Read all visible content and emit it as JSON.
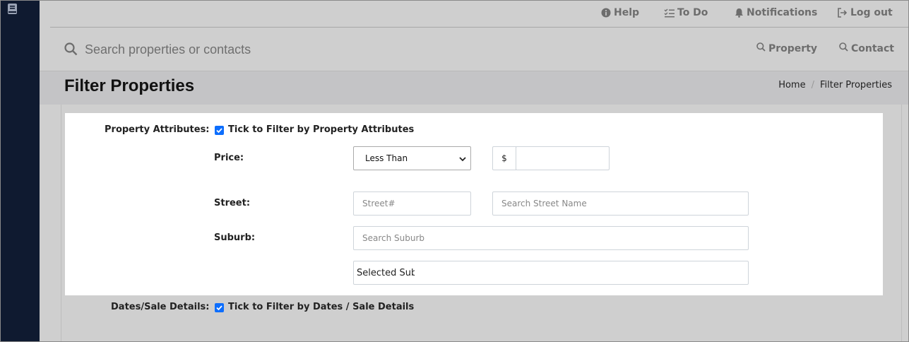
{
  "topnav": {
    "help": "Help",
    "todo": "To Do",
    "notifications": "Notifications",
    "logout": "Log out"
  },
  "search": {
    "placeholder": "Search properties or contacts",
    "property_label": "Property",
    "contact_label": "Contact"
  },
  "page": {
    "title": "Filter Properties",
    "breadcrumb": [
      "Home",
      "Filter Properties"
    ]
  },
  "filters": {
    "property_attributes": {
      "label": "Property Attributes:",
      "checkbox_label": "Tick to Filter by Property Attributes",
      "checked": true,
      "price": {
        "label": "Price:",
        "comparator": "Less Than",
        "currency": "$",
        "value": ""
      },
      "street": {
        "label": "Street:",
        "number_placeholder": "Street#",
        "name_placeholder": "Search Street Name"
      },
      "suburb": {
        "label": "Suburb:",
        "search_placeholder": "Search Suburb",
        "selected_value": "Selected Subu"
      }
    },
    "dates_sale": {
      "label": "Dates/Sale Details:",
      "checkbox_label": "Tick to Filter by Dates / Sale Details",
      "checked": true
    }
  },
  "colors": {
    "sidebar": "#0f1a30",
    "accent": "#0d6efd",
    "background": "#cfcfcf",
    "panel": "#ffffff"
  },
  "icons": [
    "book-icon",
    "info-icon",
    "checklist-icon",
    "bell-icon",
    "logout-icon",
    "search-icon",
    "chevron-down-icon",
    "check-icon"
  ]
}
